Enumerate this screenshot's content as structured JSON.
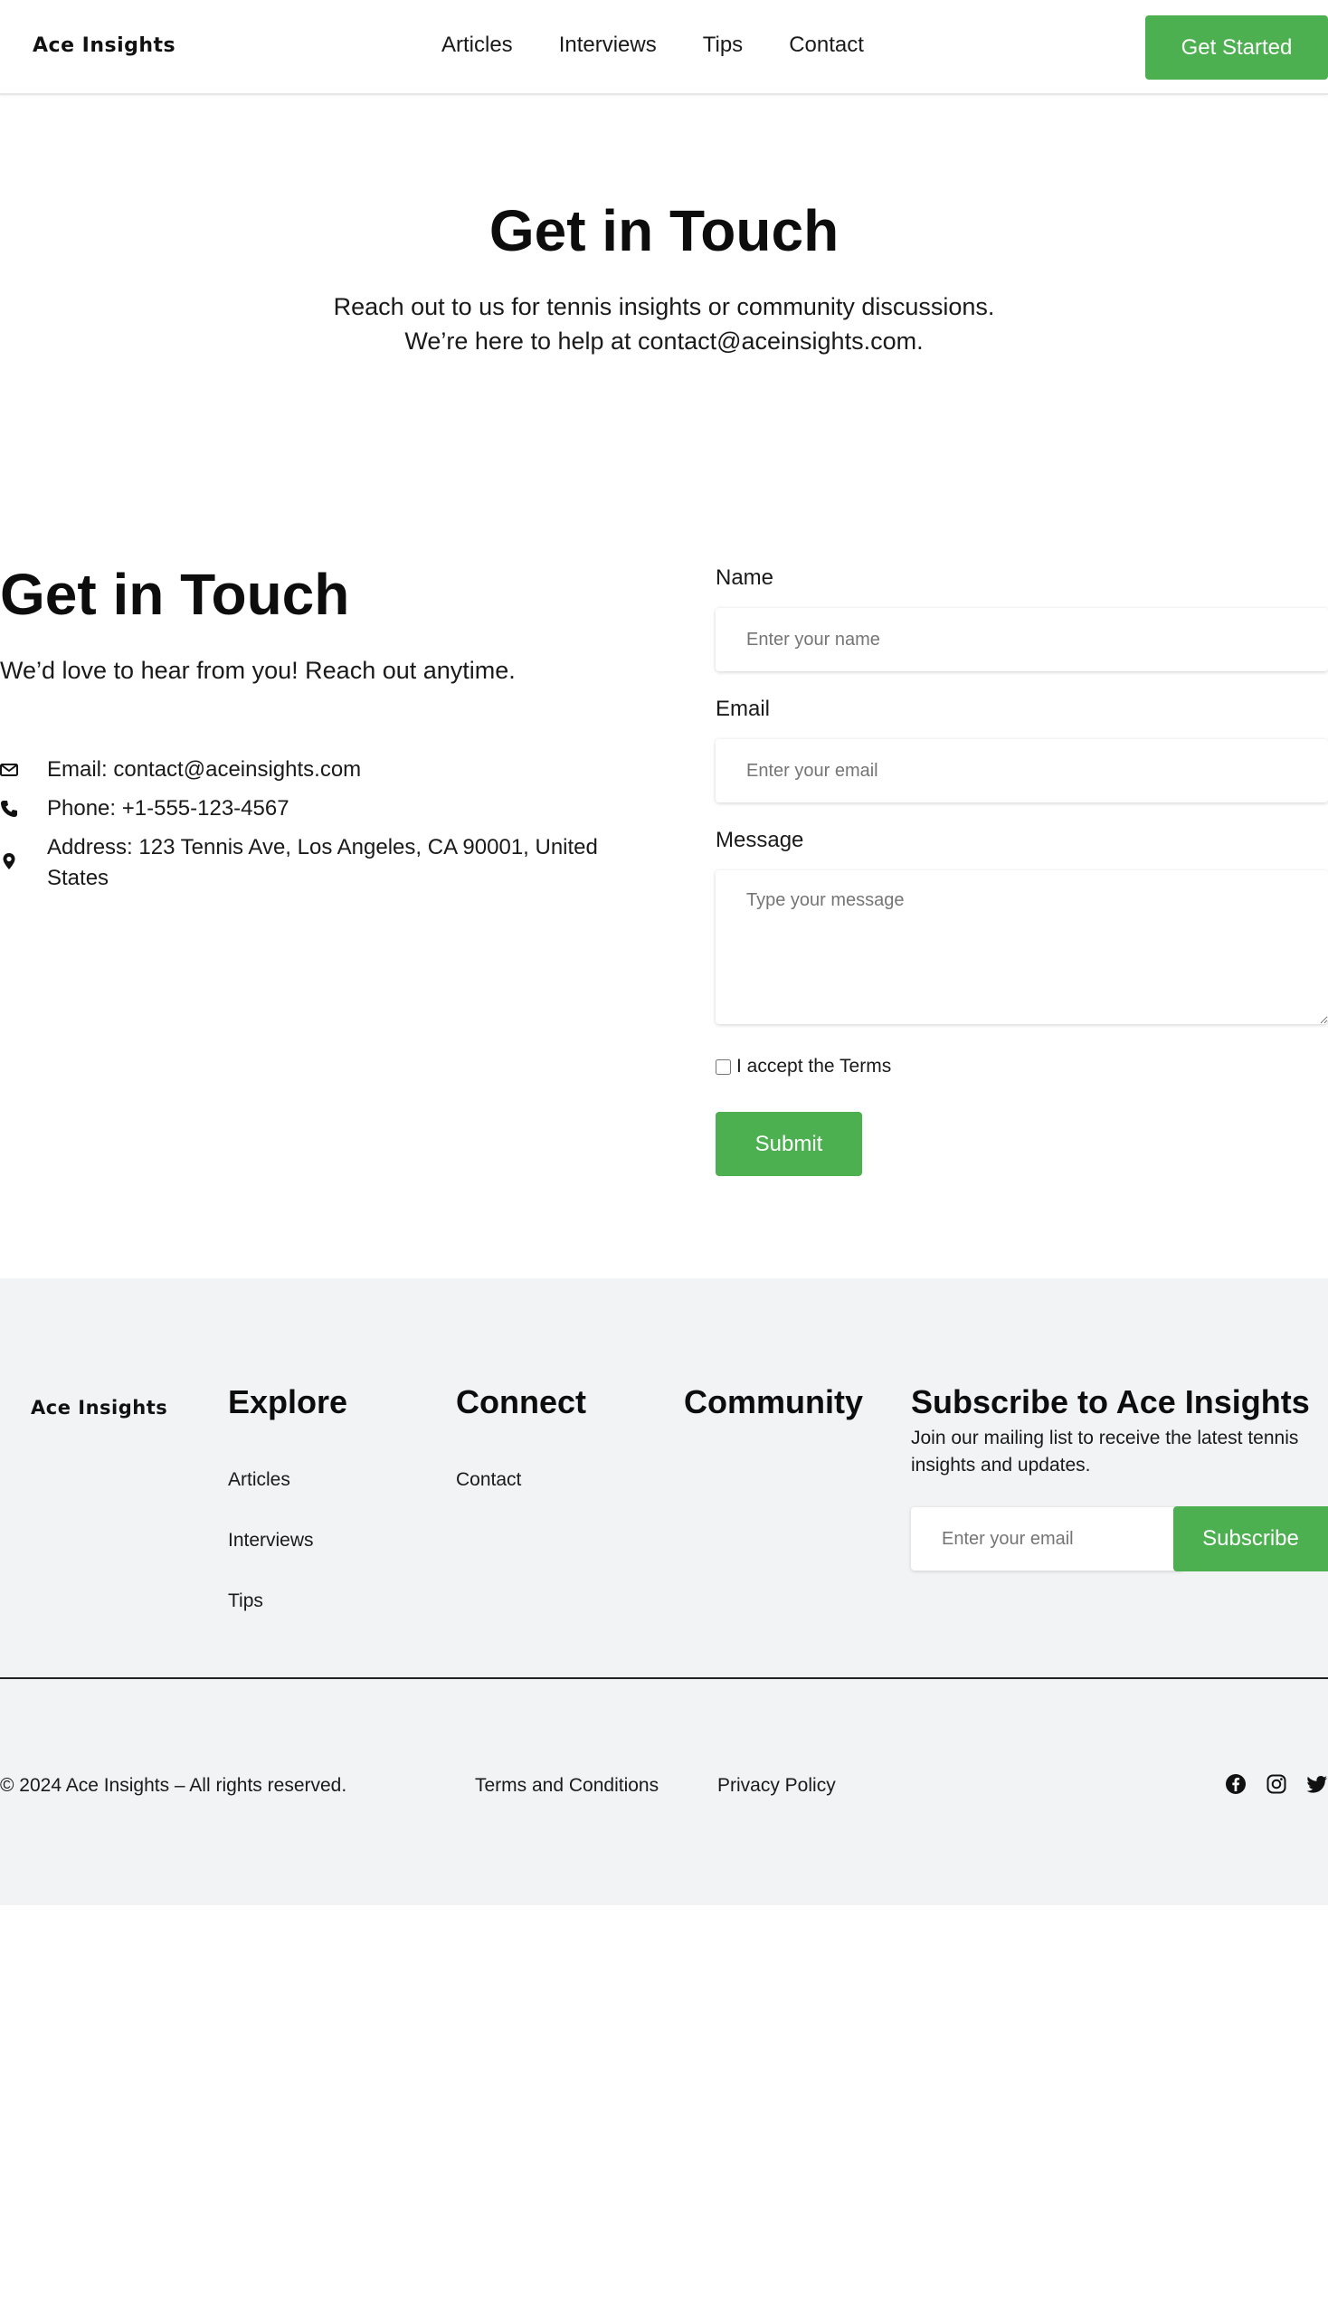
{
  "header": {
    "logo": "Ace Insights",
    "nav": [
      "Articles",
      "Interviews",
      "Tips",
      "Contact"
    ],
    "cta_label": "Get Started"
  },
  "hero": {
    "title": "Get in Touch",
    "subtitle_line1": "Reach out to us for tennis insights or community discussions.",
    "subtitle_line2": "We’re here to help at contact@aceinsights.com."
  },
  "contact": {
    "title": "Get in Touch",
    "subtitle": "We’d love to hear from you! Reach out anytime.",
    "email": "Email: contact@aceinsights.com",
    "phone": "Phone: +1-555-123-4567",
    "address": "Address: 123 Tennis Ave, Los Angeles, CA 90001, United States"
  },
  "form": {
    "name_label": "Name",
    "name_placeholder": "Enter your name",
    "email_label": "Email",
    "email_placeholder": "Enter your email",
    "message_label": "Message",
    "message_placeholder": "Type your message",
    "terms_label": "I accept the Terms",
    "terms_checked": false,
    "submit_label": "Submit"
  },
  "footer": {
    "logo": "Ace Insights",
    "explore_title": "Explore",
    "explore_links": [
      "Articles",
      "Interviews",
      "Tips"
    ],
    "connect_title": "Connect",
    "connect_links": [
      "Contact"
    ],
    "community_title": "Community",
    "subscribe_title": "Subscribe to Ace Insights",
    "subscribe_text": "Join our mailing list to receive the latest tennis insights and updates.",
    "subscribe_placeholder": "Enter your email",
    "subscribe_label": "Subscribe",
    "copyright": "© 2024 Ace Insights – All rights reserved.",
    "terms_link": "Terms and Conditions",
    "privacy_link": "Privacy Policy",
    "social_icons": [
      "facebook-icon",
      "instagram-icon",
      "twitter-icon"
    ]
  },
  "colors": {
    "accent": "#4caf50",
    "footer_bg": "#f2f3f5"
  }
}
